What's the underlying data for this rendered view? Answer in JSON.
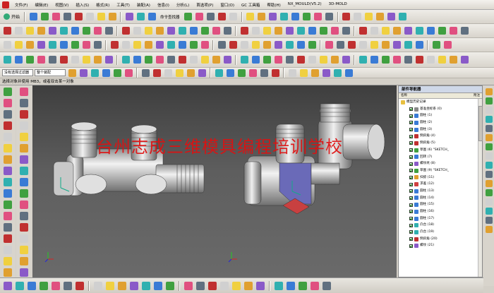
{
  "menu": [
    "文件(F)",
    "编辑(E)",
    "视图(V)",
    "插入(S)",
    "格式(R)",
    "工具(T)",
    "装配(A)",
    "信息(I)",
    "分析(L)",
    "首选项(P)",
    "窗口(O)",
    "GC 工具箱",
    "帮助(H)",
    "NX_MOULD(V5.2)",
    "3D-MOLD"
  ],
  "toolbar": {
    "start_label": "开始",
    "command_finder": "命令查找器"
  },
  "selection_bar": {
    "filter": "没有选择过滤器",
    "scope": "整个装配"
  },
  "status_text": "选择对象并使用 MB3，或者双击某一对象",
  "watermark": "台州志成三维模具编程培训学校",
  "navigator": {
    "title": "部件导航器",
    "col_name": "名称",
    "col_latest": "附注",
    "root": "模型历史记录",
    "items": [
      "基准坐标系 (0)",
      "圆柱 (1)",
      "圆柱 (2)",
      "圆柱 (3)",
      "倒斜角 (4)",
      "倒斜角 (5)",
      "草图 (6) \"SKETCH_",
      "回转 (7)",
      "螺纹坑 (8)",
      "草图 (9) \"SKETCH_",
      "扫掠 (11)",
      "求差 (12)",
      "圆柱 (13)",
      "圆柱 (14)",
      "圆柱 (15)",
      "圆柱 (16)",
      "圆柱 (17)",
      "凸台 (18)",
      "凸台 (19)",
      "倒斜角 (20)",
      "螺纹 (21)"
    ]
  },
  "colors": {
    "viewport_top": "#3e3e3e",
    "viewport_bottom": "#6a6a6a",
    "watermark": "#e01010",
    "part": "#d0d0d0",
    "section": "#6a6ab8"
  }
}
